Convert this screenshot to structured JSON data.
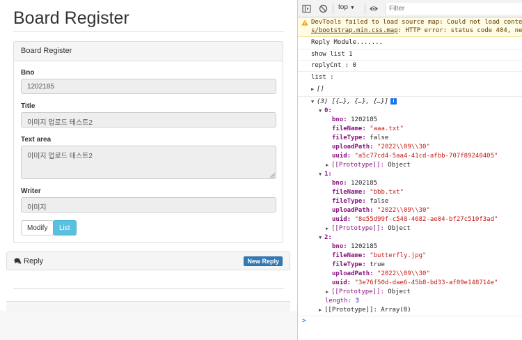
{
  "page": {
    "title": "Board Register",
    "panel_heading": "Board Register",
    "fields": {
      "bno": {
        "label": "Bno",
        "value": "1202185"
      },
      "title": {
        "label": "Title",
        "value": "이미지 업로드 테스트2"
      },
      "content": {
        "label": "Text area",
        "value": "이미지 업로드 테스트2"
      },
      "writer": {
        "label": "Writer",
        "value": "이미지"
      }
    },
    "buttons": {
      "modify": "Modify",
      "list": "List"
    },
    "reply": {
      "label": "Reply",
      "new_reply_button": "New Reply"
    }
  },
  "devtools": {
    "toolbar": {
      "context": "top",
      "filter_placeholder": "Filter",
      "icons": [
        "sidebar-toggle-icon",
        "clear-console-icon",
        "eye-icon"
      ]
    },
    "warning": {
      "line1": "DevTools failed to load source map: Could not load conte",
      "link": "s/bootstrap.min.css.map",
      "line2_rest": ": HTTP error: status code 404, ne"
    },
    "logs": [
      "Reply Module.......",
      "show list 1",
      "replyCnt : 0",
      "list :"
    ],
    "empty_array": "[]",
    "array_summary": "(3) [{…}, {…}, {…}]",
    "items": [
      {
        "index": "0:",
        "bno": "1202185",
        "fileName": "\"aaa.txt\"",
        "fileType": "false",
        "uploadPath": "\"2022\\\\09\\\\30\"",
        "uuid": "\"a5c77cd4-5aa4-41cd-afbb-707f89240405\""
      },
      {
        "index": "1:",
        "bno": "1202185",
        "fileName": "\"bbb.txt\"",
        "fileType": "false",
        "uploadPath": "\"2022\\\\09\\\\30\"",
        "uuid": "\"8e55d99f-c548-4682-ae04-bf27c510f3ad\""
      },
      {
        "index": "2:",
        "bno": "1202185",
        "fileName": "\"butterfly.jpg\"",
        "fileType": "true",
        "uploadPath": "\"2022\\\\09\\\\30\"",
        "uuid": "\"3e76f50d-dae6-45b8-bd33-af09e148714e\""
      }
    ],
    "keys": {
      "bno": "bno:",
      "fileName": "fileName:",
      "fileType": "fileType:",
      "uploadPath": "uploadPath:",
      "uuid": "uuid:",
      "prototype": "[[Prototype]]:",
      "length": "length:"
    },
    "object_proto": "Object",
    "length_value": "3",
    "array_proto": "Array(0)",
    "prompt": ">",
    "colors": {
      "key": "#881280",
      "number": "#1c00cf",
      "string": "#c41a16",
      "info_badge": "#1a73e8"
    }
  }
}
